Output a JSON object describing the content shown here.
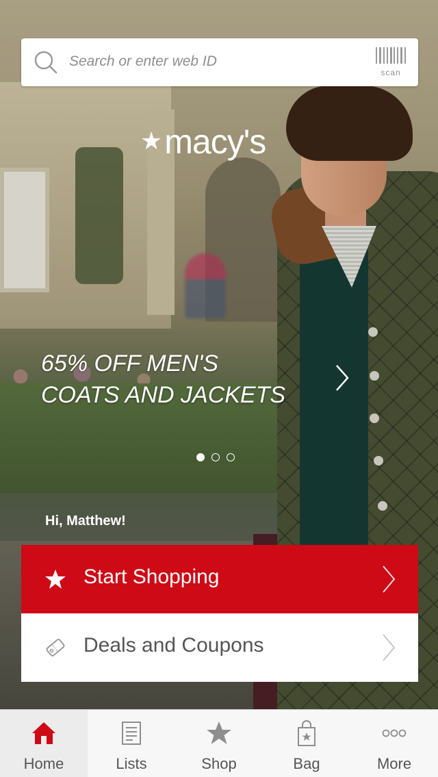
{
  "search": {
    "placeholder": "Search or enter web ID",
    "scan_label": "scan"
  },
  "brand": {
    "name": "macy's",
    "accent_color": "#cd0a16"
  },
  "promo": {
    "line1": "65% OFF MEN'S",
    "line2": "COATS AND JACKETS",
    "carousel": {
      "total": 3,
      "active": 1
    }
  },
  "greeting": "Hi, Matthew!",
  "actions": [
    {
      "label": "Start Shopping",
      "icon": "star-icon"
    },
    {
      "label": "Deals and Coupons",
      "icon": "coupon-icon"
    }
  ],
  "tabs": [
    {
      "label": "Home",
      "icon": "home-icon",
      "active": true
    },
    {
      "label": "Lists",
      "icon": "lists-icon",
      "active": false
    },
    {
      "label": "Shop",
      "icon": "star-icon",
      "active": false
    },
    {
      "label": "Bag",
      "icon": "bag-icon",
      "active": false
    },
    {
      "label": "More",
      "icon": "more-icon",
      "active": false
    }
  ]
}
